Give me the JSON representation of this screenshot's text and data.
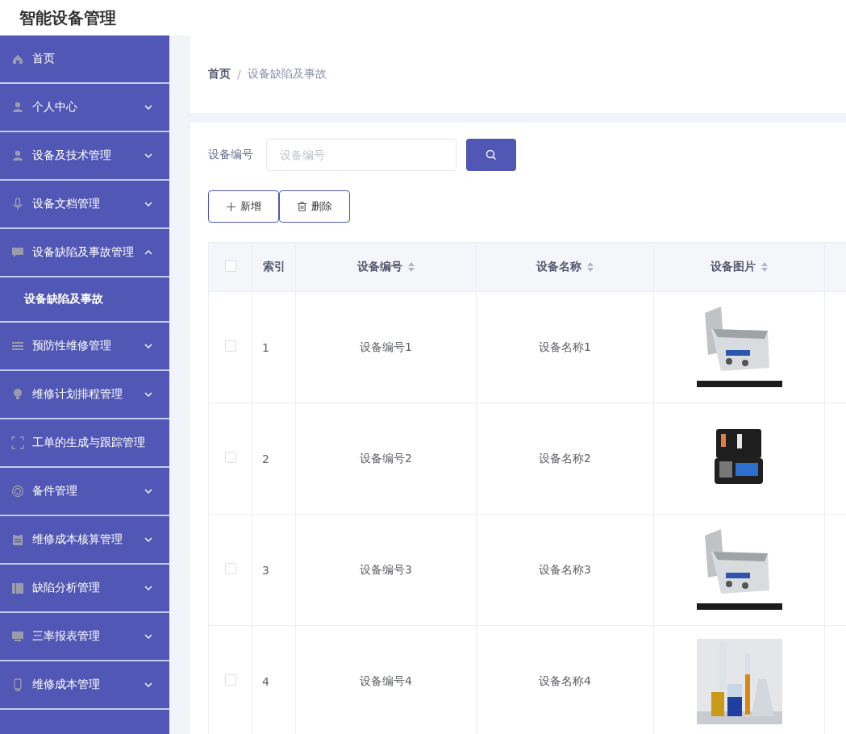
{
  "header": {
    "title": "智能设备管理"
  },
  "sidebar": {
    "items": [
      {
        "label": "首页"
      },
      {
        "label": "个人中心",
        "expanded": false
      },
      {
        "label": "设备及技术管理",
        "expanded": false
      },
      {
        "label": "设备文档管理",
        "expanded": false
      },
      {
        "label": "设备缺陷及事故管理",
        "expanded": true,
        "children": [
          {
            "label": "设备缺陷及事故"
          }
        ]
      },
      {
        "label": "预防性维修管理",
        "expanded": false
      },
      {
        "label": "维修计划排程管理",
        "expanded": false
      },
      {
        "label": "工单的生成与跟踪管理"
      },
      {
        "label": "备件管理",
        "expanded": false
      },
      {
        "label": "维修成本核算管理",
        "expanded": false
      },
      {
        "label": "缺陷分析管理",
        "expanded": false
      },
      {
        "label": "三率报表管理",
        "expanded": false
      },
      {
        "label": "维修成本管理",
        "expanded": false
      }
    ]
  },
  "breadcrumb": {
    "separator": "/",
    "items": [
      {
        "label": "首页"
      },
      {
        "label": "设备缺陷及事故"
      }
    ]
  },
  "search": {
    "label": "设备编号",
    "placeholder": "设备编号"
  },
  "actions": [
    {
      "label": "新增",
      "kind": "add"
    },
    {
      "label": "删除",
      "kind": "delete"
    }
  ],
  "table": {
    "select_all": {
      "checked": false
    },
    "columns": [
      {
        "label": "索引",
        "sortable": false
      },
      {
        "label": "设备编号",
        "sortable": true
      },
      {
        "label": "设备名称",
        "sortable": true
      },
      {
        "label": "设备图片",
        "sortable": true
      }
    ],
    "rows": [
      {
        "checked": false,
        "index": "1",
        "code": "设备编号1",
        "name": "设备名称1"
      },
      {
        "checked": false,
        "index": "2",
        "code": "设备编号2",
        "name": "设备名称2"
      },
      {
        "checked": false,
        "index": "3",
        "code": "设备编号3",
        "name": "设备名称3"
      },
      {
        "checked": false,
        "index": "4",
        "code": "设备编号4",
        "name": "设备名称4"
      }
    ]
  }
}
